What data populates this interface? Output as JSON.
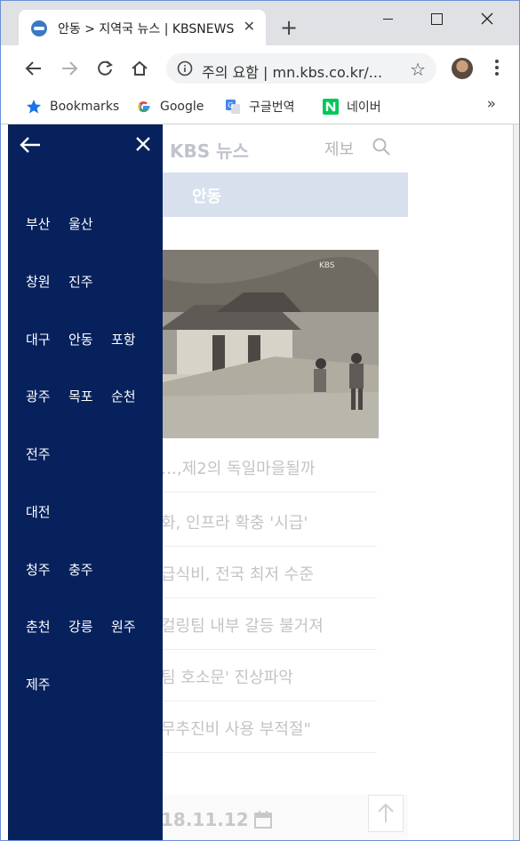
{
  "browser": {
    "tab_title": "안동 > 지역국 뉴스 | KBSNEWS",
    "tab_close": "✕",
    "new_tab": "+",
    "omnibox_text": "주의 요함 | mn.kbs.co.kr/...",
    "bookmarks": [
      {
        "label": "Bookmarks",
        "icon": "star-icon"
      },
      {
        "label": "Google",
        "icon": "google-icon"
      },
      {
        "label": "구글번역",
        "icon": "translate-icon"
      },
      {
        "label": "네이버",
        "icon": "naver-icon"
      }
    ],
    "bookmarks_more": "»"
  },
  "site": {
    "logo": "KBS 뉴스",
    "report_label": "제보",
    "region": "안동",
    "news": [
      "…,제2의 독일마을될까",
      "화, 인프라 확충 '시급'",
      "급식비, 전국 최저 수준",
      "컬링팀 내부 갈등 불거져",
      "팀 호소문' 진상파악",
      "무추진비 사용 부적절\""
    ],
    "date": "18.11.12"
  },
  "drawer": {
    "rows": [
      [
        "부산",
        "울산"
      ],
      [
        "창원",
        "진주"
      ],
      [
        "대구",
        "안동",
        "포항"
      ],
      [
        "광주",
        "목포",
        "순천"
      ],
      [
        "전주"
      ],
      [
        "대전"
      ],
      [
        "청주",
        "충주"
      ],
      [
        "춘천",
        "강릉",
        "원주"
      ],
      [
        "제주"
      ]
    ]
  },
  "colors": {
    "drawer_bg": "#07215c",
    "region_bar": "#d8e0ee",
    "window_border": "#6b8fd6"
  }
}
